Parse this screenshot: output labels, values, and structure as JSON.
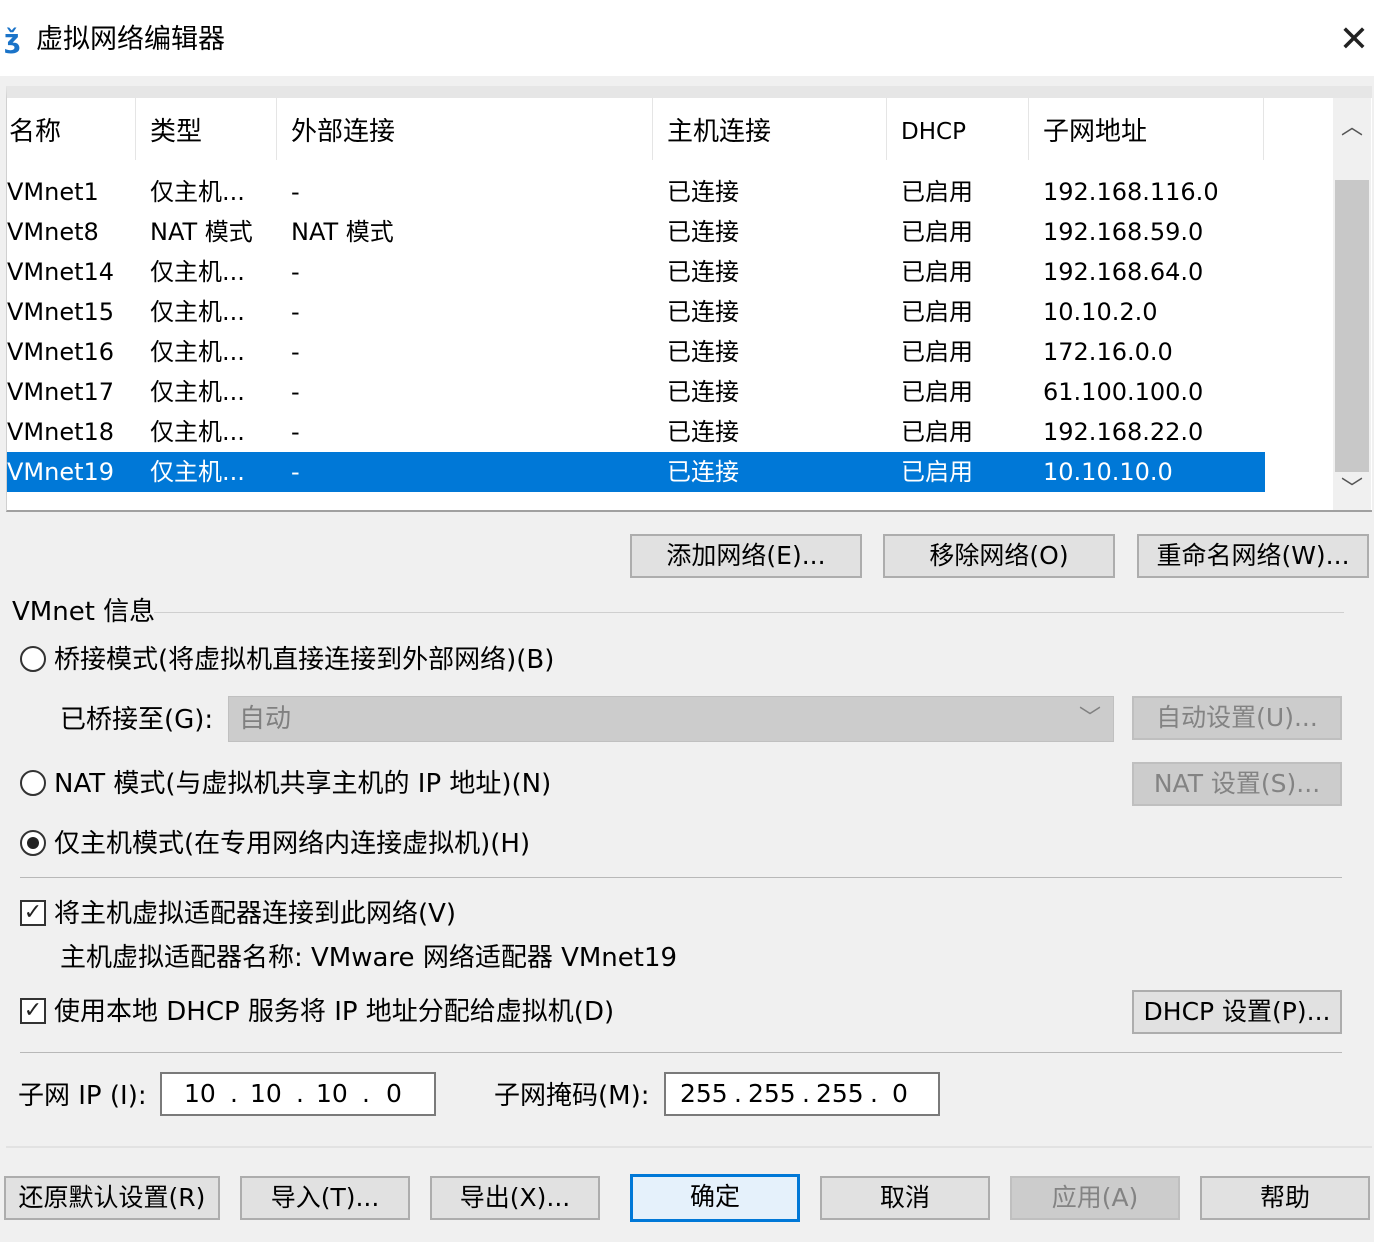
{
  "window": {
    "title": "虚拟网络编辑器",
    "close_glyph": "✕",
    "icon_glyph": "ǯ"
  },
  "table": {
    "columns": [
      "名称",
      "类型",
      "外部连接",
      "主机连接",
      "DHCP",
      "子网地址"
    ],
    "rows": [
      {
        "name": "VMnet1",
        "type": "仅主机...",
        "external": "-",
        "host": "已连接",
        "dhcp": "已启用",
        "subnet": "192.168.116.0"
      },
      {
        "name": "VMnet8",
        "type": "NAT 模式",
        "external": "NAT 模式",
        "host": "已连接",
        "dhcp": "已启用",
        "subnet": "192.168.59.0"
      },
      {
        "name": "VMnet14",
        "type": "仅主机...",
        "external": "-",
        "host": "已连接",
        "dhcp": "已启用",
        "subnet": "192.168.64.0"
      },
      {
        "name": "VMnet15",
        "type": "仅主机...",
        "external": "-",
        "host": "已连接",
        "dhcp": "已启用",
        "subnet": "10.10.2.0"
      },
      {
        "name": "VMnet16",
        "type": "仅主机...",
        "external": "-",
        "host": "已连接",
        "dhcp": "已启用",
        "subnet": "172.16.0.0"
      },
      {
        "name": "VMnet17",
        "type": "仅主机...",
        "external": "-",
        "host": "已连接",
        "dhcp": "已启用",
        "subnet": "61.100.100.0"
      },
      {
        "name": "VMnet18",
        "type": "仅主机...",
        "external": "-",
        "host": "已连接",
        "dhcp": "已启用",
        "subnet": "192.168.22.0"
      },
      {
        "name": "VMnet19",
        "type": "仅主机...",
        "external": "-",
        "host": "已连接",
        "dhcp": "已启用",
        "subnet": "10.10.10.0",
        "selected": true
      }
    ],
    "scroll_up_glyph": "︿",
    "scroll_down_glyph": "﹀"
  },
  "list_buttons": {
    "add": "添加网络(E)...",
    "remove": "移除网络(O)",
    "rename": "重命名网络(W)..."
  },
  "vmnet_info": {
    "section_label": "VMnet 信息",
    "bridged_label": "桥接模式(将虚拟机直接连接到外部网络)(B)",
    "bridged_to_label": "已桥接至(G):",
    "bridged_to_value": "自动",
    "auto_settings": "自动设置(U)...",
    "nat_label": "NAT 模式(与虚拟机共享主机的 IP 地址)(N)",
    "nat_settings": "NAT 设置(S)...",
    "hostonly_label": "仅主机模式(在专用网络内连接虚拟机)(H)",
    "selected_mode": "hostonly",
    "connect_adapter_label": "将主机虚拟适配器连接到此网络(V)",
    "connect_adapter_checked": true,
    "adapter_name_label": "主机虚拟适配器名称: VMware 网络适配器 VMnet19",
    "dhcp_label": "使用本地 DHCP 服务将 IP 地址分配给虚拟机(D)",
    "dhcp_checked": true,
    "dhcp_settings": "DHCP 设置(P)...",
    "subnet_ip_label": "子网 IP (I):",
    "subnet_ip": [
      "10",
      "10",
      "10",
      "0"
    ],
    "subnet_mask_label": "子网掩码(M):",
    "subnet_mask": [
      "255",
      "255",
      "255",
      "0"
    ],
    "check_glyph": "✓"
  },
  "footer_buttons": {
    "restore": "还原默认设置(R)",
    "import": "导入(T)...",
    "export": "导出(X)...",
    "ok": "确定",
    "cancel": "取消",
    "apply": "应用(A)",
    "help": "帮助"
  },
  "colors": {
    "selection": "#0078d7",
    "dialog_bg": "#f0f0f0",
    "disabled_text": "#838383"
  }
}
